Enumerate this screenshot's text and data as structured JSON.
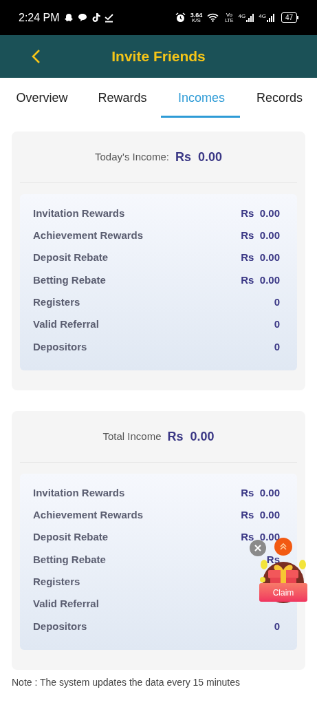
{
  "status_bar": {
    "time": "2:24 PM",
    "speed": "3.64",
    "speed_unit": "K/S",
    "volte_top": "Vo",
    "volte_bottom": "LTE",
    "network_1": "4G",
    "network_2": "4G",
    "battery": "47"
  },
  "header": {
    "title": "Invite Friends"
  },
  "tabs": [
    {
      "label": "Overview",
      "selected": false
    },
    {
      "label": "Rewards",
      "selected": false
    },
    {
      "label": "Incomes",
      "selected": true
    },
    {
      "label": "Records",
      "selected": false
    }
  ],
  "cards": [
    {
      "title": "Today's Income:",
      "amount": "Rs  0.00",
      "rows": [
        {
          "label": "Invitation Rewards",
          "value": "Rs  0.00"
        },
        {
          "label": "Achievement Rewards",
          "value": "Rs  0.00"
        },
        {
          "label": "Deposit Rebate",
          "value": "Rs  0.00"
        },
        {
          "label": "Betting Rebate",
          "value": "Rs  0.00"
        },
        {
          "label": "Registers",
          "value": "0"
        },
        {
          "label": "Valid Referral",
          "value": "0"
        },
        {
          "label": "Depositors",
          "value": "0"
        }
      ]
    },
    {
      "title": "Total Income",
      "amount": "Rs  0.00",
      "rows": [
        {
          "label": "Invitation Rewards",
          "value": "Rs  0.00"
        },
        {
          "label": "Achievement Rewards",
          "value": "Rs  0.00"
        },
        {
          "label": "Deposit Rebate",
          "value": "Rs  0.00"
        },
        {
          "label": "Betting Rebate",
          "value": "Rs"
        },
        {
          "label": "Registers"
        },
        {
          "label": "Valid Referral"
        },
        {
          "label": "Depositors",
          "value": "0"
        }
      ]
    }
  ],
  "floating_claim": {
    "label": "Claim"
  },
  "note": "Note : The system updates the data every 15 minutes"
}
